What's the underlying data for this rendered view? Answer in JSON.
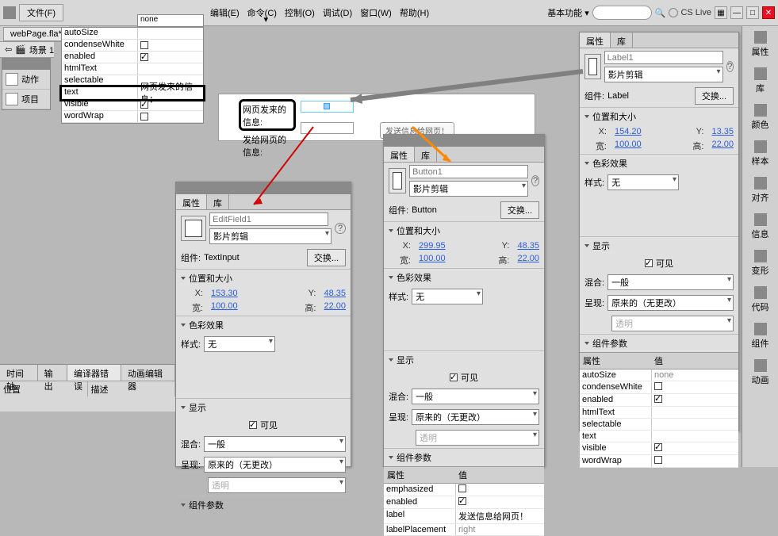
{
  "app": {
    "file_menu": "文件(F)",
    "dropdown_label": "基本功能 ▾",
    "cslive": "CS Live"
  },
  "menu": [
    "编辑(E)",
    "命令(C)",
    "控制(O)",
    "调试(D)",
    "窗口(W)",
    "帮助(H)"
  ],
  "doc_tab": "webPage.fla*",
  "scene": "场景 1",
  "left_actions": [
    "动作",
    "项目"
  ],
  "topgrid": {
    "none": "none",
    "rows": [
      {
        "k": "autoSize",
        "v": ""
      },
      {
        "k": "condenseWhite",
        "v": "off"
      },
      {
        "k": "enabled",
        "v": "on"
      },
      {
        "k": "htmlText",
        "v": ""
      },
      {
        "k": "selectable",
        "v": ""
      },
      {
        "k": "text",
        "v": "网页发来的信息："
      },
      {
        "k": "visible",
        "v": "on"
      },
      {
        "k": "wordWrap",
        "v": "off"
      }
    ]
  },
  "stage": {
    "label1": "网页发来的信息:",
    "label2": "发给网页的信息:",
    "btn": "发送信息给网页！"
  },
  "panels": {
    "props_tab": "属性",
    "lib_tab": "库",
    "clip_dd": "影片剪辑",
    "swap_btn": "交换...",
    "comp_label": "组件:",
    "sect_pos": "位置和大小",
    "sect_color": "色彩效果",
    "sect_display": "显示",
    "sect_params": "组件参数",
    "style_lab": "样式:",
    "style_none": "无",
    "visible_lab": "可见",
    "blend_lab": "混合:",
    "blend_normal": "一般",
    "render_lab": "呈现:",
    "render_orig": "原来的（无更改）",
    "trans": "透明",
    "prop_col": "属性",
    "val_col": "值"
  },
  "panel_edit": {
    "name": "EditField1",
    "type": "TextInput",
    "x": "153.30",
    "y": "48.35",
    "w": "100.00",
    "h": "22.00"
  },
  "panel_btn": {
    "name": "Button1",
    "type": "Button",
    "x": "299.95",
    "y": "48.35",
    "w": "100.00",
    "h": "22.00",
    "params": [
      {
        "k": "emphasized",
        "v": "off"
      },
      {
        "k": "enabled",
        "v": "on"
      },
      {
        "k": "label",
        "v": "发送信息给网页！"
      },
      {
        "k": "labelPlacement",
        "v": "right"
      }
    ]
  },
  "panel_lbl": {
    "name": "Label1",
    "type": "Label",
    "x": "154.20",
    "y": "13.35",
    "w": "100.00",
    "h": "22.00",
    "params": [
      {
        "k": "autoSize",
        "v": "none"
      },
      {
        "k": "condenseWhite",
        "v": "off"
      },
      {
        "k": "enabled",
        "v": "on"
      },
      {
        "k": "htmlText",
        "v": ""
      },
      {
        "k": "selectable",
        "v": ""
      },
      {
        "k": "text",
        "v": ""
      },
      {
        "k": "visible",
        "v": "on"
      },
      {
        "k": "wordWrap",
        "v": "off"
      }
    ]
  },
  "rightdock": [
    "属性",
    "库",
    "颜色",
    "样本",
    "对齐",
    "信息",
    "变形",
    "代码",
    "组件",
    "动画"
  ],
  "bottom_tabs": [
    "时间轴",
    "输出",
    "编译器错误",
    "动画编辑器"
  ],
  "bottom_cols": [
    "位置",
    "描述"
  ]
}
